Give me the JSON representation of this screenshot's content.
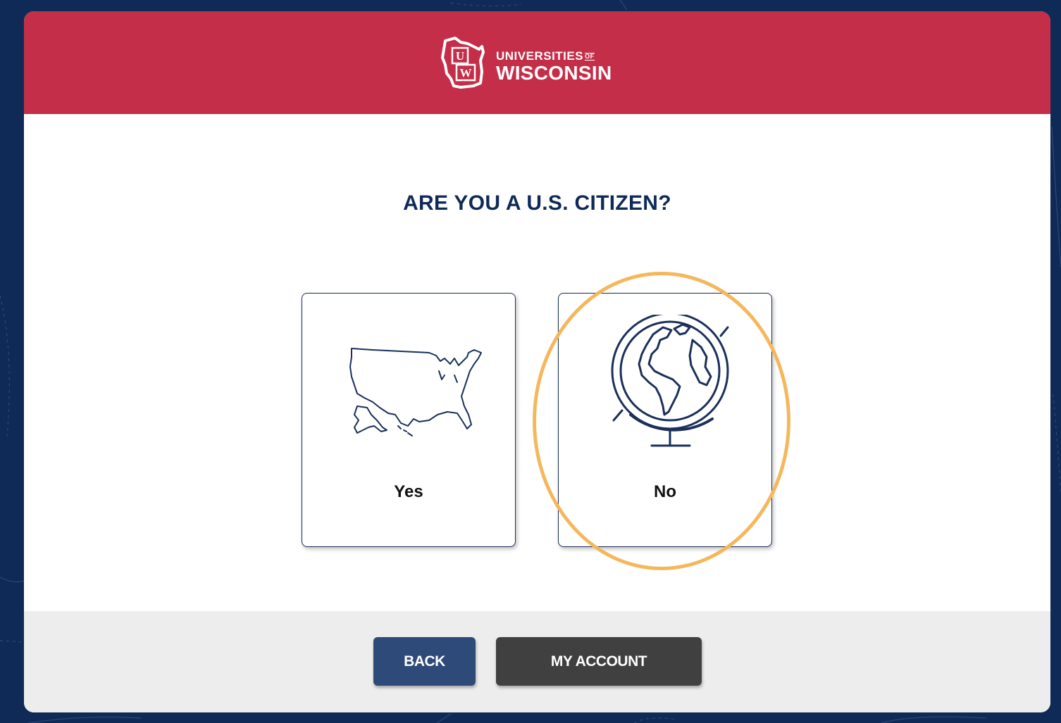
{
  "header": {
    "logo_line1": "UNIVERSITIES",
    "logo_of": "OF",
    "logo_line2": "WISCONSIN",
    "logo_initials_top": "U",
    "logo_initials_bottom": "W",
    "brand_color": "#c52e48"
  },
  "main": {
    "question": "ARE YOU A U.S. CITIZEN?",
    "options": [
      {
        "label": "Yes",
        "icon": "usa-map-icon"
      },
      {
        "label": "No",
        "icon": "globe-icon"
      }
    ],
    "highlight_color": "#f5b75c"
  },
  "footer": {
    "back_label": "BACK",
    "account_label": "MY ACCOUNT",
    "back_color": "#2e4a78",
    "account_color": "#404040"
  },
  "background_color": "#0f2a57"
}
